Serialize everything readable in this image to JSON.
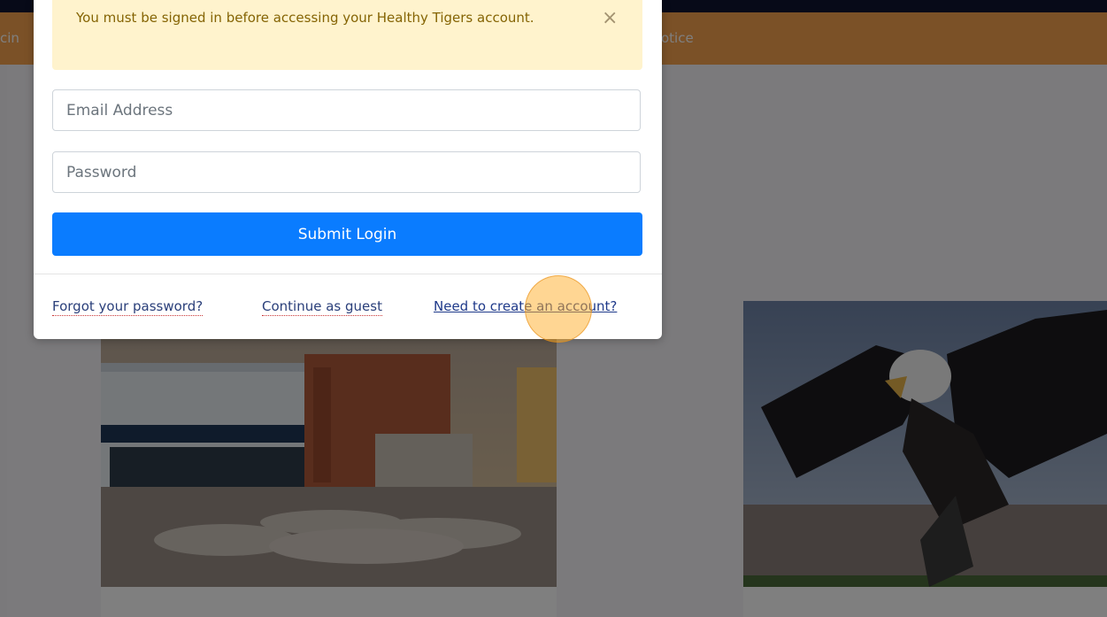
{
  "background": {
    "nav_fragment_left": "cin",
    "nav_fragment_right": "otice"
  },
  "modal": {
    "alert": {
      "message": "You must be signed in before accessing your Healthy Tigers account.",
      "close_glyph": "×"
    },
    "email": {
      "placeholder": "Email Address",
      "value": ""
    },
    "password": {
      "placeholder": "Password",
      "value": ""
    },
    "submit_label": "Submit Login",
    "links": {
      "forgot": "Forgot your password?",
      "guest": "Continue as guest",
      "create": "Need to create an account?"
    }
  },
  "colors": {
    "navbar": "#f7a24f",
    "alert_bg": "#fff3cd",
    "primary": "#0a7cff",
    "click_indicator": "#ffae28"
  },
  "icons": [
    "close-icon"
  ]
}
